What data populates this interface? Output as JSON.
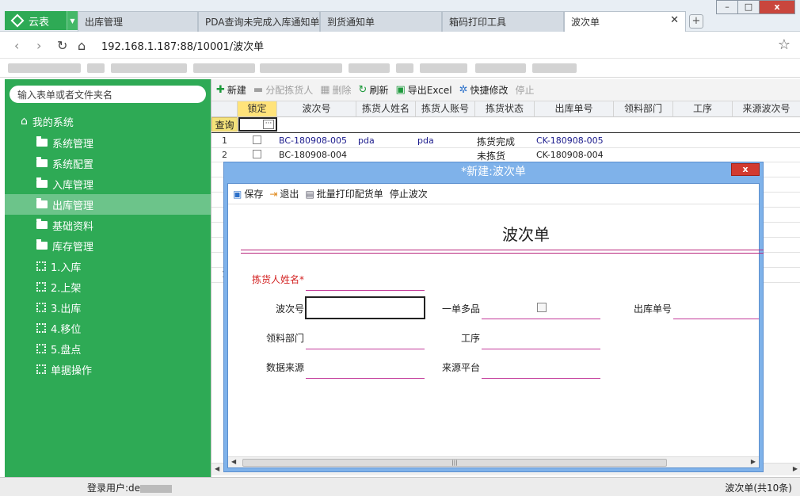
{
  "app": {
    "menu_label": "云表"
  },
  "tabs": [
    {
      "label": "出库管理"
    },
    {
      "label": "PDA查询未完成入库通知单"
    },
    {
      "label": "到货通知单"
    },
    {
      "label": "箱码打印工具"
    },
    {
      "label": "波次单",
      "active": true
    }
  ],
  "window_controls": {
    "minimize": "–",
    "maximize": "□",
    "close": "x"
  },
  "address": {
    "url": "192.168.1.187:88/10001/波次单"
  },
  "sidebar": {
    "search_placeholder": "输入表单或者文件夹名",
    "root": "我的系统",
    "items": [
      {
        "label": "系统管理",
        "icon": "folder-icon"
      },
      {
        "label": "系统配置",
        "icon": "folder-icon"
      },
      {
        "label": "入库管理",
        "icon": "folder-icon"
      },
      {
        "label": "出库管理",
        "icon": "folder-icon",
        "active": true
      },
      {
        "label": "基础资料",
        "icon": "folder-icon"
      },
      {
        "label": "库存管理",
        "icon": "folder-icon"
      },
      {
        "label": "1.入库",
        "icon": "grid-icon"
      },
      {
        "label": "2.上架",
        "icon": "grid-icon"
      },
      {
        "label": "3.出库",
        "icon": "grid-icon"
      },
      {
        "label": "4.移位",
        "icon": "grid-icon"
      },
      {
        "label": "5.盘点",
        "icon": "grid-icon"
      },
      {
        "label": "单据操作",
        "icon": "grid-icon"
      }
    ]
  },
  "toolbar": {
    "new": "新建",
    "assign": "分配拣货人",
    "delete": "删除",
    "refresh": "刷新",
    "export": "导出Excel",
    "quick_edit": "快捷修改",
    "stop": "停止"
  },
  "grid": {
    "columns": [
      "锁定",
      "波次号",
      "拣货人姓名",
      "拣货人账号",
      "拣货状态",
      "出库单号",
      "领料部门",
      "工序",
      "来源波次号"
    ],
    "query_label": "查询",
    "rows": [
      {
        "num": "1",
        "wave_no": "BC-180908-005",
        "picker_name": "pda",
        "picker_account": "pda",
        "status": "拣货完成",
        "order_no": "CK-180908-005"
      },
      {
        "num": "2",
        "wave_no": "BC-180908-004",
        "picker_name": "",
        "picker_account": "",
        "status": "未拣货",
        "order_no": "CK-180908-004"
      }
    ],
    "extra_row_num": "1"
  },
  "dialog": {
    "title": "*新建:波次单",
    "close": "x",
    "toolbar": {
      "save": "保存",
      "exit": "退出",
      "batch_print": "批量打印配货单",
      "stop_wave": "停止波次"
    },
    "form_title": "波次单",
    "fields": {
      "picker_name": "拣货人姓名*",
      "wave_no": "波次号",
      "multi_item": "一单多品",
      "order_no": "出库单号",
      "department": "领料部门",
      "process": "工序",
      "data_source": "数据来源",
      "source_platform": "来源平台"
    }
  },
  "status": {
    "user_label": "登录用户:de",
    "record_info": "波次单(共10条)"
  }
}
